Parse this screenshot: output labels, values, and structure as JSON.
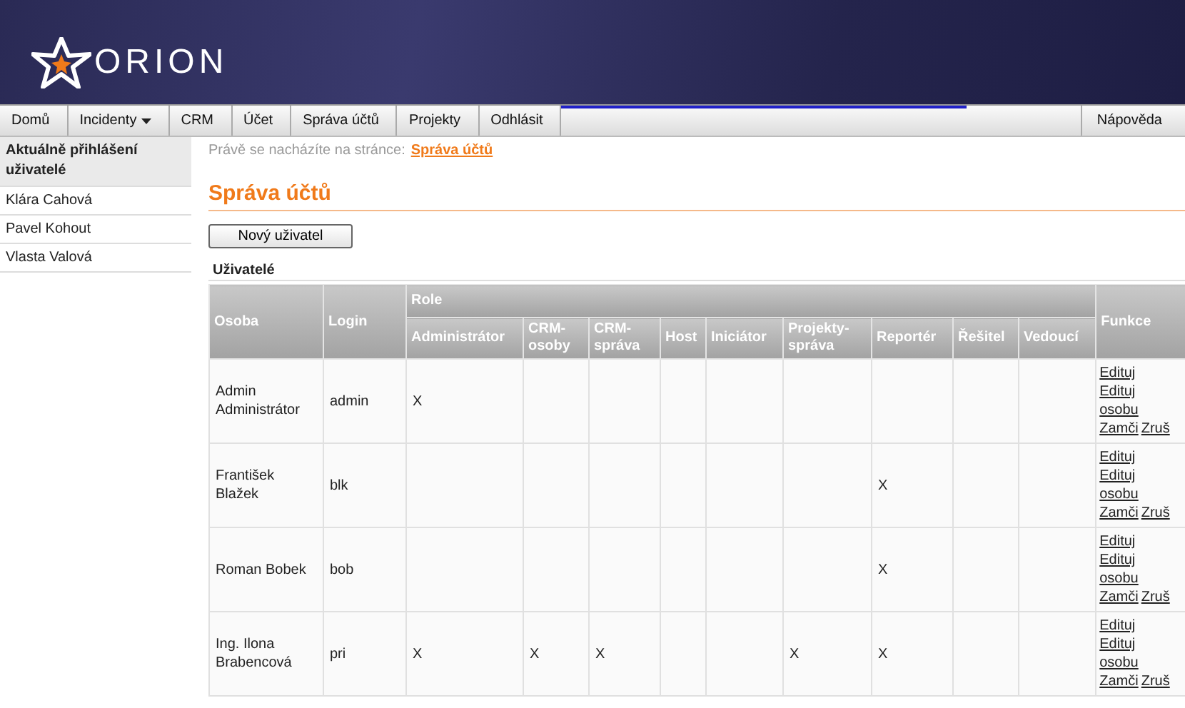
{
  "header": {
    "logo_text": "ORION"
  },
  "nav": {
    "items": [
      {
        "label": "Domů",
        "kind": "link"
      },
      {
        "label": "Incidenty",
        "kind": "dropdown"
      },
      {
        "label": "CRM",
        "kind": "link"
      },
      {
        "label": "Účet",
        "kind": "link"
      },
      {
        "label": "Správa účtů",
        "kind": "link"
      },
      {
        "label": "Projekty",
        "kind": "link"
      },
      {
        "label": "Odhlásit",
        "kind": "link"
      }
    ],
    "help": "Nápověda"
  },
  "sidebar": {
    "title": "Aktuálně přihlášení uživatelé",
    "items": [
      "Klára Cahová",
      "Pavel Kohout",
      "Vlasta Valová"
    ]
  },
  "breadcrumb": {
    "prefix": "Právě se nacházíte na stránce:",
    "current": "Správa účtů"
  },
  "page_title": "Správa účtů",
  "new_user_button": "Nový uživatel",
  "table": {
    "caption": "Uživatelé",
    "columns": {
      "person": "Osoba",
      "login": "Login",
      "role_group": "Role",
      "functions": "Funkce",
      "roles": [
        "Administrátor",
        "CRM-osoby",
        "CRM-správa",
        "Host",
        "Iniciátor",
        "Projekty-správa",
        "Reportér",
        "Řešitel",
        "Vedoucí"
      ]
    },
    "rows": [
      {
        "person": "Admin Administrátor",
        "login": "admin",
        "roles": {
          "administrator": "X"
        },
        "actions": [
          "Edituj",
          "Edituj osobu",
          "Zamči",
          "Zruš"
        ]
      },
      {
        "person": "František Blažek",
        "login": "blk",
        "roles": {
          "reporter": "X"
        },
        "actions": [
          "Edituj",
          "Edituj osobu",
          "Zamči",
          "Zruš"
        ]
      },
      {
        "person": "Roman Bobek",
        "login": "bob",
        "roles": {
          "reporter": "X"
        },
        "actions": [
          "Edituj",
          "Edituj osobu",
          "Zamči",
          "Zruš"
        ]
      },
      {
        "person": "Ing. Ilona Brabencová",
        "login": "pri",
        "roles": {
          "administrator": "X",
          "crm_persons": "X",
          "crm_admin": "X",
          "projects_admin": "X",
          "reporter": "X"
        },
        "actions": [
          "Edituj",
          "Edituj osobu",
          "Zamči",
          "Zruš"
        ]
      }
    ]
  }
}
